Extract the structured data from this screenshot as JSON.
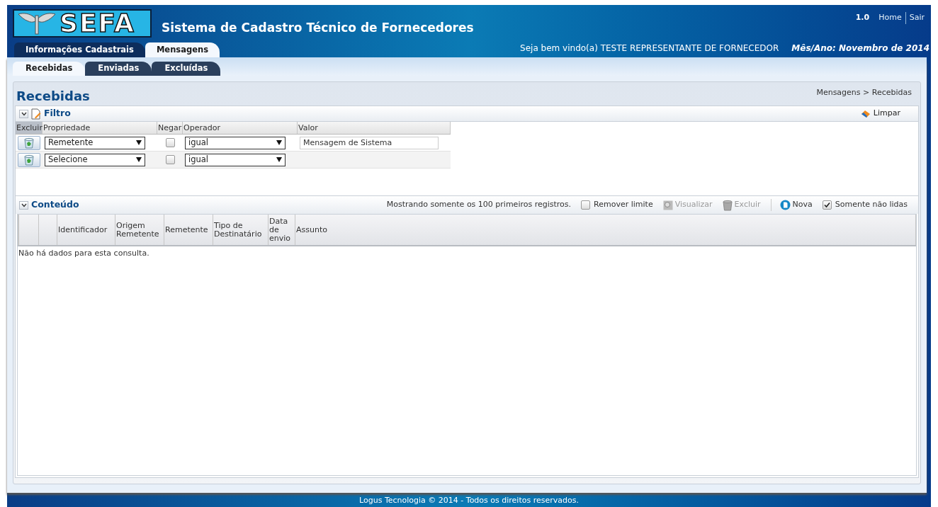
{
  "header": {
    "logo_text": "SEFA",
    "title": "Sistema de Cadastro Técnico de Fornecedores",
    "version": "1.0",
    "links": [
      "Home",
      "Sair"
    ],
    "welcome": "Seja bem vindo(a) TESTE REPRESENTANTE DE FORNECEDOR",
    "period": "Mês/Ano: Novembro de 2014"
  },
  "main_tabs": [
    {
      "label": "Informações Cadastrais",
      "selected": false
    },
    {
      "label": "Mensagens",
      "selected": true
    }
  ],
  "sub_tabs": [
    {
      "label": "Recebidas",
      "selected": true
    },
    {
      "label": "Enviadas",
      "selected": false
    },
    {
      "label": "Excluídas",
      "selected": false
    }
  ],
  "page": {
    "title": "Recebidas",
    "breadcrumb": "Mensagens > Recebidas"
  },
  "filter": {
    "title": "Filtro",
    "expanded": true,
    "clear_button": "Limpar",
    "columns": [
      "Excluir",
      "Propriedade",
      "Negar",
      "Operador",
      "Valor"
    ],
    "rows": [
      {
        "property": "Remetente",
        "negate": false,
        "operator": "igual",
        "value": "Mensagem de Sistema"
      },
      {
        "property": "Selecione",
        "negate": false,
        "operator": "igual"
      }
    ]
  },
  "content": {
    "title": "Conteúdo",
    "expanded": true,
    "toolbar": [
      {
        "kind": "text",
        "label": "Mostrando somente os 100 primeiros registros."
      },
      {
        "kind": "checkbox",
        "label": "Remover limite",
        "checked": false
      },
      {
        "kind": "view",
        "label": "Visualizar",
        "disabled": true
      },
      {
        "kind": "delete",
        "label": "Excluir",
        "disabled": true
      },
      {
        "kind": "new",
        "label": "Nova",
        "disabled": false
      },
      {
        "kind": "checkbox",
        "label": "Somente não lidas",
        "checked": true
      }
    ],
    "columns": [
      "",
      "",
      "Identificador",
      "Origem Remetente",
      "Remetente",
      "Tipo de Destinatário",
      "Data de envio",
      "Assunto"
    ],
    "empty": "Não há dados para esta consulta."
  },
  "footer": "Logus Tecnologia © 2014 - Todos os direitos reservados."
}
